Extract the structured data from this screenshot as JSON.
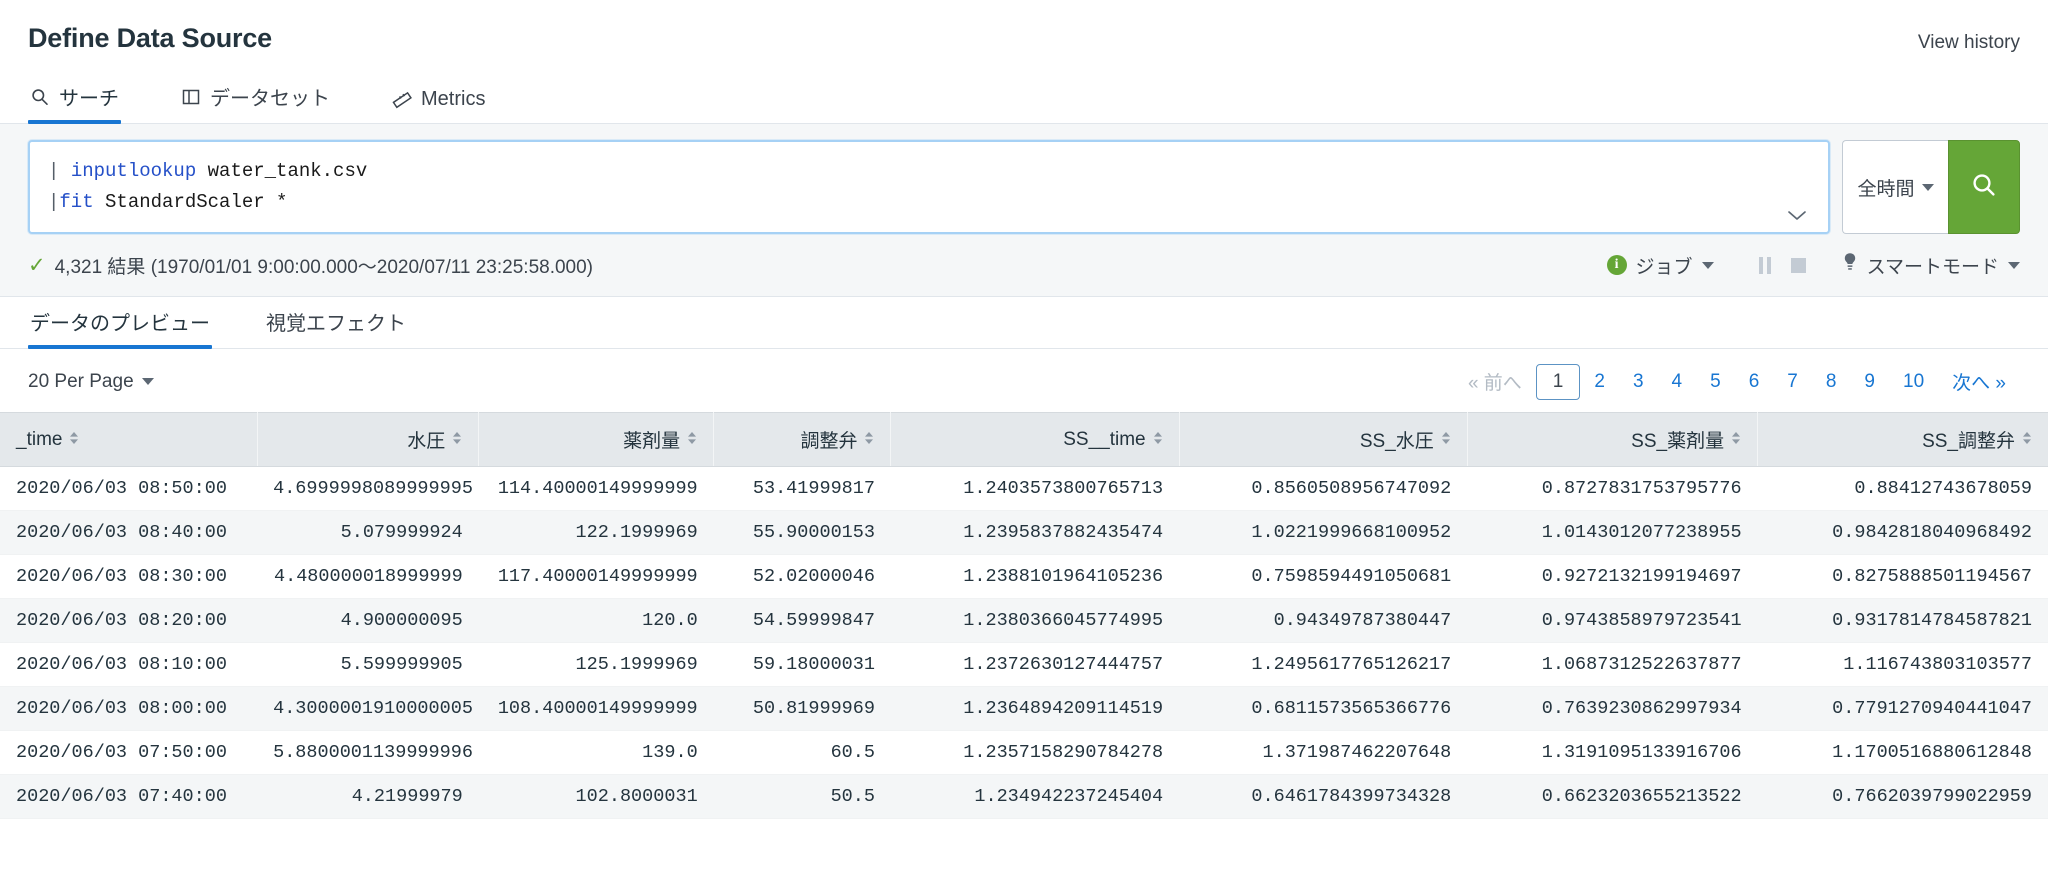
{
  "header": {
    "title": "Define Data Source",
    "view_history": "View history"
  },
  "tabs": [
    {
      "label": "サーチ",
      "icon": "search-icon",
      "active": true
    },
    {
      "label": "データセット",
      "icon": "dataset-panel-icon",
      "active": false
    },
    {
      "label": "Metrics",
      "icon": "metrics-ruler-icon",
      "active": false
    }
  ],
  "search": {
    "query_line1_pipe": "| ",
    "query_line1_cmd": "inputlookup",
    "query_line1_rest": " water_tank.csv",
    "query_line2_pipe": "|",
    "query_line2_cmd": "fit",
    "query_line2_rest": " StandardScaler *",
    "query_full": "| inputlookup water_tank.csv\n|fit StandardScaler *",
    "time_range": "全時間",
    "search_button_icon": "magnifier-icon",
    "accent_green": "#65a637",
    "accent_blue": "#1876d2"
  },
  "result_bar": {
    "status_icon": "check-icon",
    "summary": "4,321 結果 (1970/01/01 9:00:00.000〜2020/07/11 23:25:58.000)",
    "job_label": "ジョブ",
    "pause_icon": "pause-icon",
    "stop_icon": "stop-icon",
    "mode_icon": "lightbulb-icon",
    "mode_label": "スマートモード"
  },
  "subtabs": [
    {
      "label": "データのプレビュー",
      "active": true
    },
    {
      "label": "視覚エフェクト",
      "active": false
    }
  ],
  "pagination": {
    "per_page": "20 Per Page",
    "prev": "« 前へ",
    "next": "次へ »",
    "pages": [
      "1",
      "2",
      "3",
      "4",
      "5",
      "6",
      "7",
      "8",
      "9",
      "10"
    ],
    "current_page": "1"
  },
  "table": {
    "columns": [
      "_time",
      "水圧",
      "薬剤量",
      "調整弁",
      "SS__time",
      "SS_水圧",
      "SS_薬剤量",
      "SS_調整弁"
    ],
    "rows": [
      [
        "2020/06/03 08:50:00",
        "4.6999998089999995",
        "114.40000149999999",
        "53.41999817",
        "1.2403573800765713",
        "0.8560508956747092",
        "0.8727831753795776",
        "0.88412743678059"
      ],
      [
        "2020/06/03 08:40:00",
        "5.079999924",
        "122.1999969",
        "55.90000153",
        "1.2395837882435474",
        "1.0221999668100952",
        "1.0143012077238955",
        "0.9842818040968492"
      ],
      [
        "2020/06/03 08:30:00",
        "4.480000018999999",
        "117.40000149999999",
        "52.02000046",
        "1.2388101964105236",
        "0.7598594491050681",
        "0.9272132199194697",
        "0.8275888501194567"
      ],
      [
        "2020/06/03 08:20:00",
        "4.900000095",
        "120.0",
        "54.59999847",
        "1.2380366045774995",
        "0.94349787380447",
        "0.9743858979723541",
        "0.9317814784587821"
      ],
      [
        "2020/06/03 08:10:00",
        "5.599999905",
        "125.1999969",
        "59.18000031",
        "1.2372630127444757",
        "1.2495617765126217",
        "1.0687312522637877",
        "1.116743803103577"
      ],
      [
        "2020/06/03 08:00:00",
        "4.3000001910000005",
        "108.40000149999999",
        "50.81999969",
        "1.2364894209114519",
        "0.6811573565366776",
        "0.7639230862997934",
        "0.7791270940441047"
      ],
      [
        "2020/06/03 07:50:00",
        "5.8800001139999996",
        "139.0",
        "60.5",
        "1.2357158290784278",
        "1.371987462207648",
        "1.3191095133916706",
        "1.1700516880612848"
      ],
      [
        "2020/06/03 07:40:00",
        "4.21999979",
        "102.8000031",
        "50.5",
        "1.234942237245404",
        "0.6461784399734328",
        "0.6623203655213522",
        "0.7662039799022959"
      ]
    ]
  }
}
